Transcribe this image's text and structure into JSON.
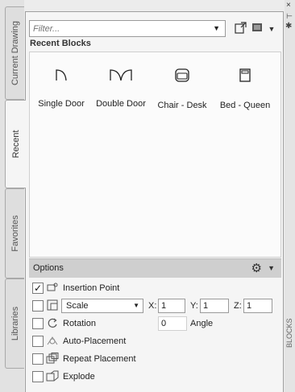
{
  "tabs": {
    "current_drawing": "Current Drawing",
    "recent": "Recent",
    "favorites": "Favorites",
    "libraries": "Libraries"
  },
  "filter": {
    "placeholder": "Filter..."
  },
  "section_title": "Recent Blocks",
  "blocks": [
    {
      "label": "Single Door",
      "icon": "single-door-icon"
    },
    {
      "label": "Double Door",
      "icon": "double-door-icon"
    },
    {
      "label": "Chair - Desk",
      "icon": "chair-desk-icon"
    },
    {
      "label": "Bed - Queen",
      "icon": "bed-queen-icon"
    }
  ],
  "options": {
    "title": "Options",
    "insertion_point": {
      "label": "Insertion Point",
      "checked": true
    },
    "scale": {
      "selected": "Scale",
      "x_label": "X:",
      "x": "1",
      "y_label": "Y:",
      "y": "1",
      "z_label": "Z:",
      "z": "1"
    },
    "rotation": {
      "label": "Rotation",
      "value": "0",
      "angle_label": "Angle"
    },
    "auto_placement": {
      "label": "Auto-Placement"
    },
    "repeat_placement": {
      "label": "Repeat Placement"
    },
    "explode": {
      "label": "Explode"
    }
  },
  "right_strip": {
    "close": "×",
    "label": "BLOCKS"
  }
}
